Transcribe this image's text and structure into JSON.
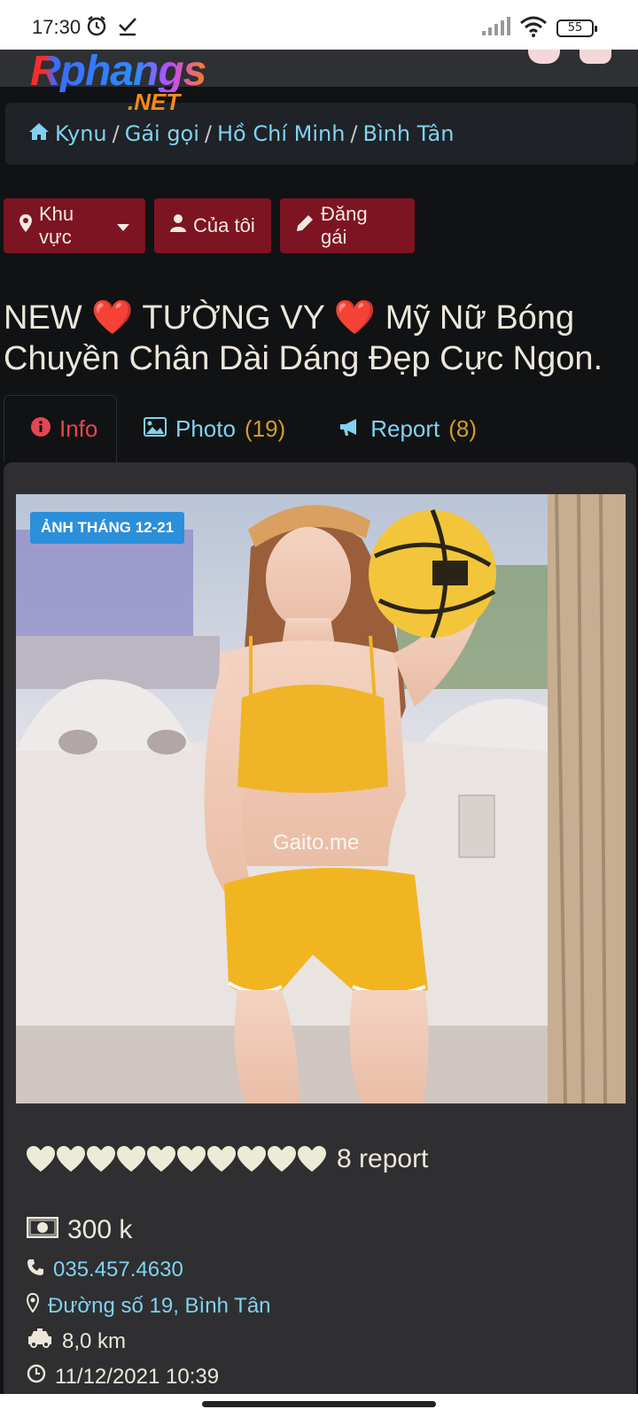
{
  "status_bar": {
    "time": "17:30",
    "battery": "55",
    "left_icons": [
      "alarm-icon",
      "check-icon"
    ],
    "right_icons": [
      "signal-icon",
      "wifi-icon",
      "battery-icon"
    ]
  },
  "header": {
    "logo_main": "Rphangs",
    "logo_sub": ".NET",
    "icons": [
      "bell-icon",
      "user-icon"
    ]
  },
  "breadcrumb": {
    "home_icon": "home-icon",
    "items": [
      "Kynu",
      "Gái gọi",
      "Hồ Chí Minh",
      "Bình Tân"
    ],
    "separator": "/"
  },
  "actions": [
    {
      "label": "Khu vực",
      "icon": "map-marker-icon",
      "has_caret": true
    },
    {
      "label": "Của tôi",
      "icon": "user-icon"
    },
    {
      "label": "Đăng gái",
      "icon": "pencil-icon"
    }
  ],
  "post": {
    "title_part1": "NEW",
    "title_heart": "❤️",
    "title_part2": "TƯỜNG VY",
    "title_part3": "Mỹ Nữ Bóng Chuyền Chân Dài Dáng Đẹp Cực Ngon."
  },
  "tabs": [
    {
      "label": "Info",
      "icon": "info-icon",
      "count": "",
      "active": true
    },
    {
      "label": "Photo",
      "icon": "image-icon",
      "count": "(19)",
      "active": false
    },
    {
      "label": "Report",
      "icon": "bullhorn-icon",
      "count": "(8)",
      "active": false
    }
  ],
  "photo": {
    "badge": "ẢNH THÁNG 12-21",
    "watermark": "Gaito.me"
  },
  "details": {
    "rating_hearts": 10,
    "report_text": "8 report",
    "price": "300 k",
    "phone": "035.457.4630",
    "address": "Đường số 19, Bình Tân",
    "distance": "8,0 km",
    "datetime": "11/12/2021 10:39"
  },
  "colors": {
    "accent_red": "#7d1422",
    "link_blue": "#7fd3f0",
    "count_orange": "#d49a2a",
    "badge_blue": "#2b8fd9"
  }
}
